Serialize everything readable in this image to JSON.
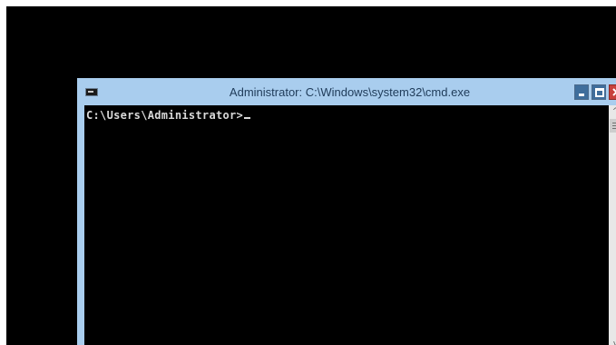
{
  "window": {
    "title": "Administrator: C:\\Windows\\system32\\cmd.exe",
    "icon": "cmd-icon"
  },
  "controls": {
    "minimize_icon": "minimize-icon",
    "maximize_icon": "maximize-icon",
    "close_icon": "close-icon"
  },
  "console": {
    "prompt": "C:\\Users\\Administrator>"
  },
  "scrollbar": {
    "up_glyph": "^",
    "down_glyph": "v"
  },
  "colors": {
    "background": "#000000",
    "title_bar": "#a9cdee",
    "close_button": "#c7423d",
    "console_text": "#d9d9d9"
  }
}
